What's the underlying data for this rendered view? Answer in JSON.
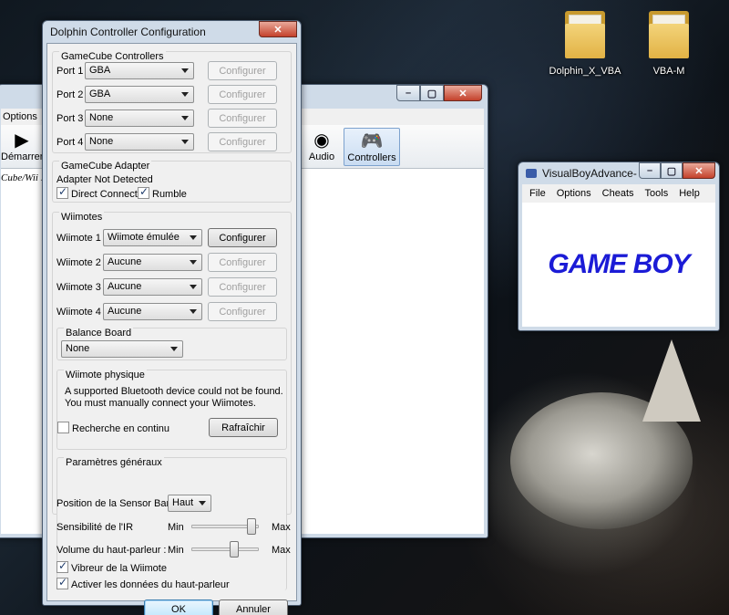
{
  "desktop": {
    "icons": [
      {
        "label": "Dolphin_X_VBA"
      },
      {
        "label": "VBA-M"
      }
    ]
  },
  "dolphin_main": {
    "menu_options": "Options",
    "toolbar": {
      "play_label": "Démarrer",
      "audio_label": "Audio",
      "controllers_label": "Controllers"
    },
    "list_header": "Cube/Wii IS"
  },
  "vba": {
    "title": "VisualBoyAdvance-",
    "menu": [
      "File",
      "Options",
      "Cheats",
      "Tools",
      "Help"
    ],
    "logo_text": "GAME BOY",
    "logo_color": "#1b1bd6"
  },
  "dialog": {
    "title": "Dolphin Controller Configuration",
    "gamecube": {
      "title": "GameCube Controllers",
      "ports": [
        {
          "label": "Port 1",
          "value": "GBA",
          "button": "Configurer"
        },
        {
          "label": "Port 2",
          "value": "GBA",
          "button": "Configurer"
        },
        {
          "label": "Port 3",
          "value": "None",
          "button": "Configurer"
        },
        {
          "label": "Port 4",
          "value": "None",
          "button": "Configurer"
        }
      ]
    },
    "adapter": {
      "title": "GameCube Adapter",
      "status": "Adapter Not Detected",
      "direct_connect": "Direct Connect",
      "rumble": "Rumble"
    },
    "wiimotes": {
      "title": "Wiimotes",
      "items": [
        {
          "label": "Wiimote 1",
          "value": "Wiimote émulée",
          "button": "Configurer"
        },
        {
          "label": "Wiimote 2",
          "value": "Aucune",
          "button": "Configurer"
        },
        {
          "label": "Wiimote 3",
          "value": "Aucune",
          "button": "Configurer"
        },
        {
          "label": "Wiimote 4",
          "value": "Aucune",
          "button": "Configurer"
        }
      ]
    },
    "balance_board": {
      "title": "Balance Board",
      "value": "None"
    },
    "physical": {
      "title": "Wiimote physique",
      "message_line1": "A supported Bluetooth device could not be found.",
      "message_line2": "You must manually connect your Wiimotes.",
      "continuous_scan": "Recherche en continu",
      "refresh_button": "Rafraîchir"
    },
    "general": {
      "title": "Paramètres généraux",
      "sensor_bar_label": "Position de la Sensor Bar :",
      "sensor_bar_value": "Haut",
      "ir_label": "Sensibilité de l'IR",
      "ir_min": "Min",
      "ir_max": "Max",
      "ir_level": 0.95,
      "speaker_label": "Volume du haut-parleur :",
      "speaker_min": "Min",
      "speaker_max": "Max",
      "speaker_level": 0.65,
      "rumble_label": "Vibreur de la Wiimote",
      "speaker_data_label": "Activer les données du haut-parleur"
    },
    "ok_button": "OK",
    "cancel_button": "Annuler"
  }
}
